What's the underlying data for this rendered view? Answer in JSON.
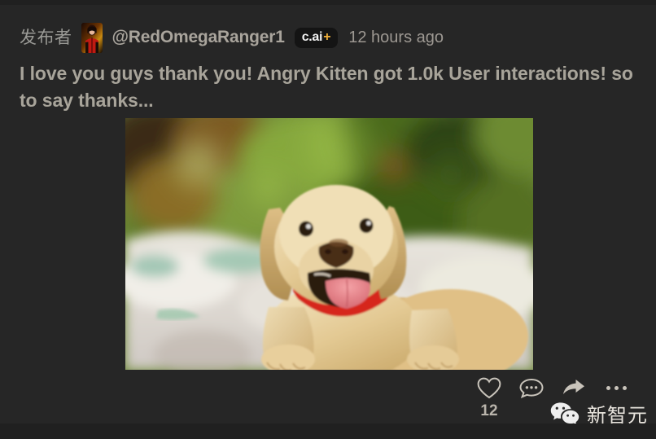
{
  "post": {
    "posted_by_label": "发布者",
    "handle": "@RedOmegaRanger1",
    "badge_text": "c.ai",
    "badge_plus": "+",
    "timestamp": "12 hours ago",
    "body_text": "I love you guys thank you! Angry Kitten got 1.0k User interactions! so to say thanks...",
    "avatar_alt": "avatar"
  },
  "image": {
    "alt": "golden labrador puppy with red collar lying on a blanket"
  },
  "actions": {
    "like_count": "12",
    "like_icon": "heart-icon",
    "comment_icon": "comment-icon",
    "share_icon": "share-icon",
    "more_icon": "more-options-icon"
  },
  "watermark": {
    "logo": "wechat-logo",
    "text": "新智元"
  },
  "colors": {
    "background": "#252525",
    "card": "#262626",
    "text": "#a8a49a",
    "muted": "#9a9a96",
    "badge_plus": "#f3b13a",
    "icon": "#c9c4bb"
  }
}
